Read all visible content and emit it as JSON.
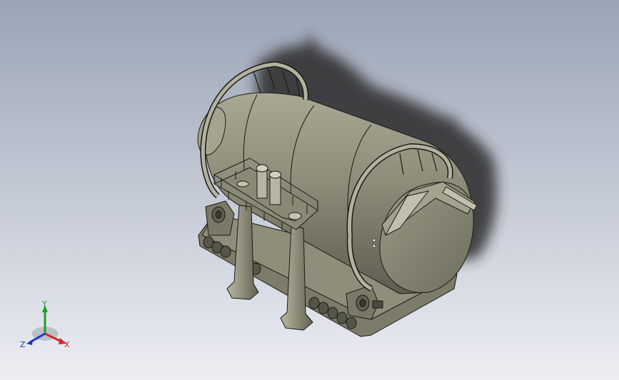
{
  "viewport": {
    "background_top": "#9aa4b6",
    "background_bottom": "#eceef3"
  },
  "model": {
    "body_color": "#8c8b78",
    "body_light": "#a6a591",
    "body_dark": "#5b5a4c",
    "edge_color": "#1a1a16",
    "shadow_color": "#2c2c2c"
  },
  "triad": {
    "x_label": "X",
    "y_label": "Y",
    "z_label": "Z",
    "x_color": "#d4262a",
    "y_color": "#1ca11c",
    "z_color": "#2233c7",
    "icon": "coordinate-triad-icon"
  }
}
